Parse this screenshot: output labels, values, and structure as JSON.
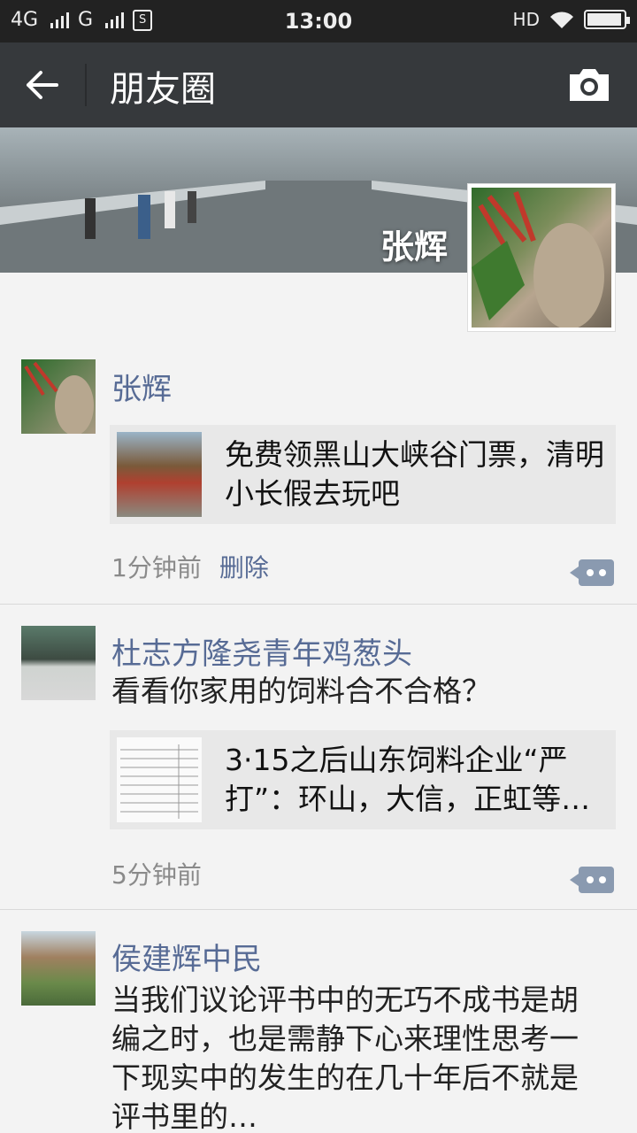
{
  "status_bar": {
    "network1": "4G",
    "network2": "G",
    "time": "13:00",
    "hd": "HD"
  },
  "nav": {
    "title": "朋友圈"
  },
  "cover": {
    "user_name": "张辉"
  },
  "posts": [
    {
      "author": "张辉",
      "text": "",
      "share_title": "免费领黑山大峡谷门票，清明小长假去玩吧",
      "time": "1分钟前",
      "delete_label": "删除"
    },
    {
      "author": "杜志方隆尧青年鸡葱头",
      "text": "看看你家用的饲料合不合格？",
      "share_title": "3·15之后山东饲料企业“严打”：环山，大信，正虹等…",
      "time": "5分钟前"
    },
    {
      "author": "侯建辉中民",
      "text": "当我们议论评书中的无巧不成书是胡编之时，也是需静下心来理性思考一下现实中的发生的在几十年后不就是评书里的…"
    }
  ],
  "colors": {
    "nav_bg": "#36393c",
    "link": "#576b95",
    "page_bg": "#f3f3f3"
  },
  "icons": [
    "back-arrow-icon",
    "camera-icon",
    "comment-icon",
    "wifi-icon",
    "battery-icon",
    "sim-icon"
  ]
}
